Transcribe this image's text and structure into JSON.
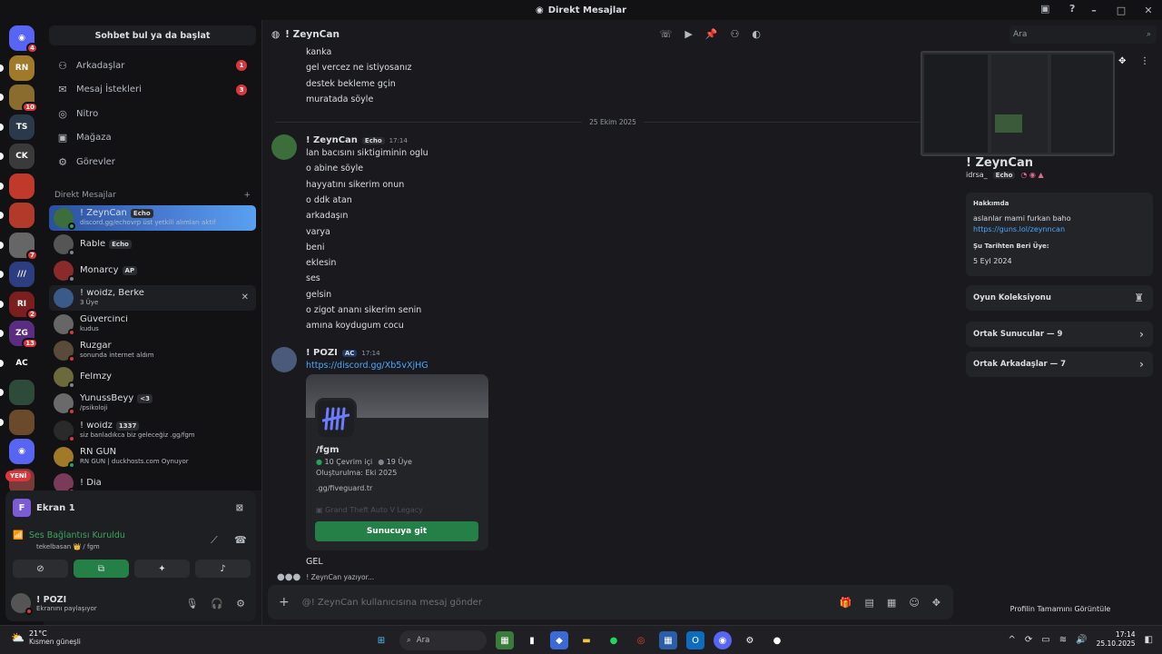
{
  "window": {
    "title": "Direkt Mesajlar",
    "icon": "discord-icon"
  },
  "servers": [
    {
      "label": "",
      "color": "#5865f2",
      "badge": "4",
      "icon": "discord-icon"
    },
    {
      "label": "RN",
      "color": "#a07a28",
      "badge": ""
    },
    {
      "label": "",
      "color": "#8a6d2e",
      "badge": "10"
    },
    {
      "label": "TS",
      "color": "#2a3a4a",
      "badge": ""
    },
    {
      "label": "CK",
      "color": "#3a3a3a",
      "badge": ""
    },
    {
      "label": "",
      "color": "#c0392b",
      "badge": ""
    },
    {
      "label": "",
      "color": "#b23a2a",
      "badge": ""
    },
    {
      "label": "",
      "color": "#666",
      "badge": "7"
    },
    {
      "label": "///",
      "color": "#2c3e80",
      "badge": ""
    },
    {
      "label": "RI",
      "color": "#7a1e1e",
      "badge": "2"
    },
    {
      "label": "ZG",
      "color": "#5a2d82",
      "badge": "13"
    },
    {
      "label": "AC",
      "color": "#121214",
      "badge": ""
    },
    {
      "label": "",
      "color": "#2e4a3a",
      "badge": ""
    },
    {
      "label": "",
      "color": "#6a4a2a",
      "badge": ""
    },
    {
      "label": "",
      "color": "#5865f2",
      "badge": "",
      "icon": "discord-icon"
    },
    {
      "label": "",
      "color": "#7a3a3a",
      "badge": ""
    }
  ],
  "new_badge": "YENİ",
  "sidebar": {
    "search_label": "Sohbet bul ya da başlat",
    "nav": [
      {
        "label": "Arkadaşlar",
        "icon": "friends-icon",
        "badge": "1"
      },
      {
        "label": "Mesaj İstekleri",
        "icon": "mail-icon",
        "badge": "3"
      },
      {
        "label": "Nitro",
        "icon": "nitro-icon",
        "badge": ""
      },
      {
        "label": "Mağaza",
        "icon": "shop-icon",
        "badge": ""
      },
      {
        "label": "Görevler",
        "icon": "quests-icon",
        "badge": ""
      }
    ],
    "dm_header": "Direkt Mesajlar",
    "dm_add": "+",
    "dms": [
      {
        "name": "! ZeynCan",
        "tag": "Echo",
        "sub": "discord.gg/echovrp üst yetkili alımları aktif",
        "color": "#3b6e3b",
        "status": "#23a55a"
      },
      {
        "name": "Rable",
        "tag": "Echo",
        "sub": "",
        "color": "#555",
        "status": "#80848e"
      },
      {
        "name": "Monarcy",
        "tag": "AP",
        "sub": "",
        "color": "#8a2a2a",
        "status": "#80848e"
      },
      {
        "name": "!       woidz, Berke",
        "tag": "",
        "sub": "3 Üye",
        "color": "#3a5a8a",
        "status": ""
      },
      {
        "name": "Güvercinci",
        "tag": "",
        "sub": "kudus",
        "color": "#666",
        "status": "#da373c"
      },
      {
        "name": "Ruzgar",
        "tag": "",
        "sub": "sonunda internet aldım",
        "color": "#5a4a3a",
        "status": "#da373c"
      },
      {
        "name": "Felmzy",
        "tag": "",
        "sub": "",
        "color": "#6a6a3a",
        "status": "#80848e"
      },
      {
        "name": "YunussBeyy",
        "tag": "<3",
        "sub": "/psikoloji",
        "color": "#6a6a6a",
        "status": "#da373c"
      },
      {
        "name": "!     woidz",
        "tag": "1337",
        "sub": "siz banladıkca biz geleceğiz .gg/fgm",
        "color": "#2a2a2a",
        "status": "#da373c"
      },
      {
        "name": "RN GUN",
        "tag": "",
        "sub": "RN GUN | duckhosts.com Oynuyor",
        "color": "#a07a28",
        "status": "#23a55a"
      },
      {
        "name": "! Dia",
        "tag": "",
        "sub": "",
        "color": "#7a3a5a",
        "status": "#da373c"
      }
    ]
  },
  "voice": {
    "screen_label": "Ekran 1",
    "screen_letter": "F",
    "status": "Ses Bağlantısı Kuruldu",
    "channel": "tekelbasan 👑 / fgm"
  },
  "me": {
    "name": "! POZI",
    "sub": "Ekranını paylaşıyor"
  },
  "chat": {
    "recipient": "! ZeynCan",
    "prev_lines": [
      "kanka",
      "gel vercez ne istiyosanız",
      "destek bekleme gçin",
      "muratada söyle"
    ],
    "date_divider": "25 Ekim 2025",
    "msg1": {
      "author": "! ZeynCan",
      "tag": "Echo",
      "time": "17:14",
      "lines": [
        "lan bacısını siktigiminin oglu",
        "o abine söyle",
        "hayyatını sikerim onun",
        "o ddk atan",
        "arkadaşın",
        "varya",
        "beni",
        "eklesin",
        "ses",
        "gelsin",
        "o zigot ananı sikerim senin",
        "amına koydugum cocu"
      ]
    },
    "msg2": {
      "author": "!      POZI",
      "tag": "AC",
      "time": "17:14",
      "link": "https://discord.gg/Xb5vXjHG",
      "invite": {
        "name": "/fgm",
        "online": "10 Çevrim içi",
        "members": "19 Üye",
        "created": "Oluşturulma: Eki 2025",
        "url": ".gg/fiveguard.tr",
        "game": "Grand Theft Auto V Legacy",
        "button": "Sunucuya git"
      },
      "after": "GEL"
    },
    "typing": "! ZeynCan yazıyor...",
    "composer_placeholder": "@! ZeynCan kullanıcısına mesaj gönder"
  },
  "header_search": {
    "placeholder": "Ara"
  },
  "profile": {
    "name": "! ZeynCan",
    "username": "idrsa_",
    "tag": "Echo",
    "about_label": "Hakkımda",
    "about_text": "aslanlar mami furkan baho",
    "about_link": "https://guns.lol/zeynncan",
    "since_label": "Şu Tarihten Beri Üye:",
    "since": "5 Eyl 2024",
    "game_collection": "Oyun Koleksiyonu",
    "mutual_servers": "Ortak Sunucular — 9",
    "mutual_friends": "Ortak Arkadaşlar — 7",
    "full_profile": "Profilin Tamamını Görüntüle"
  },
  "taskbar": {
    "temp": "21°C",
    "weather": "Kısmen güneşli",
    "search": "Ara",
    "time": "17:14",
    "date": "25.10.2025"
  }
}
